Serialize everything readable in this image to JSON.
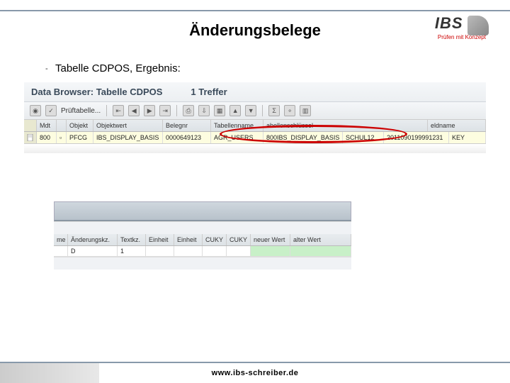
{
  "logo": {
    "main": "IBS",
    "sub": "Prüfen mit Konzept"
  },
  "title": "Änderungsbelege",
  "subtitle": "Tabelle CDPOS, Ergebnis:",
  "sap": {
    "browser_title": "Data Browser: Tabelle CDPOS",
    "hits": "1 Treffer",
    "toolbar": {
      "check_label": "Prüftabelle..."
    },
    "headers1": {
      "mdt": "Mdt",
      "objekt": "Objekt",
      "objektwert": "Objektwert",
      "belegnr": "Belegnr",
      "tabname": "Tabellenname",
      "tabkey": "abellenschlüssel",
      "fieldname": "eldname"
    },
    "row1": {
      "mdt": "800",
      "objekt": "PFCG",
      "objektwert": "IBS_DISPLAY_BASIS",
      "belegnr": "0000649123",
      "tabname": "AGR_USERS",
      "tabkey": "800IBS_DISPLAY_BASIS",
      "user": "SCHUL12",
      "stamp": "2011090199991231",
      "x": "KEY"
    },
    "headers2": {
      "me": "me",
      "chg": "Änderungskz.",
      "txt": "Textkz.",
      "unit1": "Einheit",
      "unit2": "Einheit",
      "cuky1": "CUKY",
      "cuky2": "CUKY",
      "newval": "neuer Wert",
      "oldval": "alter Wert"
    },
    "row2": {
      "chg": "D",
      "txt": "1"
    }
  },
  "footer": {
    "url": "www.ibs-schreiber.de"
  }
}
